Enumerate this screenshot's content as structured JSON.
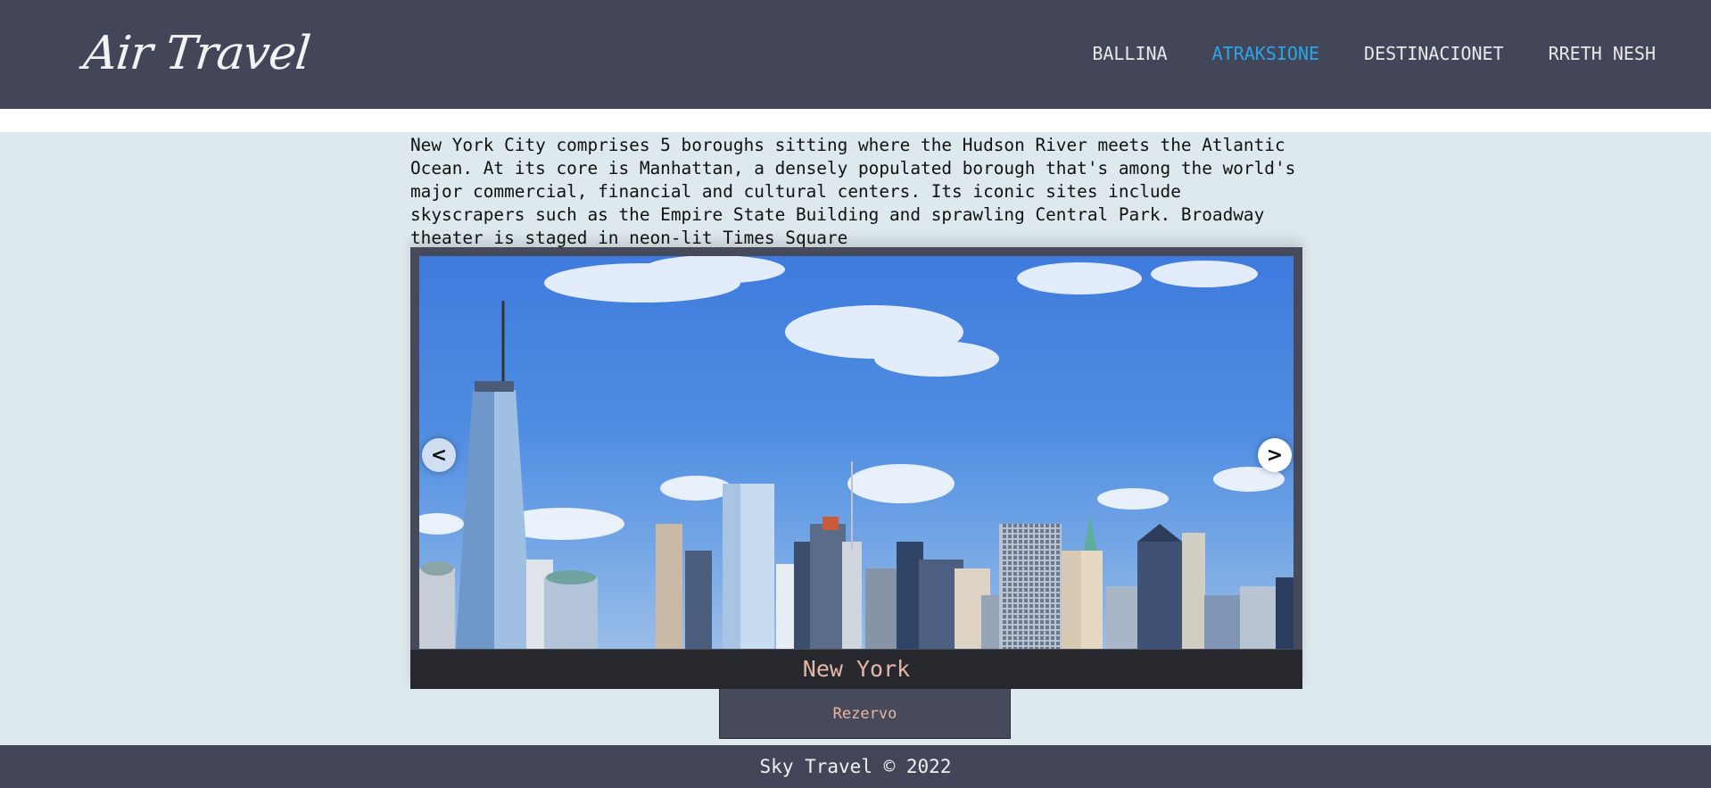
{
  "header": {
    "logo": "Air Travel",
    "nav": [
      {
        "label": "BALLINA"
      },
      {
        "label": "ATRAKSIONE"
      },
      {
        "label": "DESTINACIONET"
      },
      {
        "label": "RRETH NESH"
      }
    ],
    "active_nav": "ATRAKSIONE"
  },
  "main": {
    "description": "New York City comprises 5 boroughs sitting where the Hudson River meets the Atlantic Ocean. At its core is Manhattan, a densely populated borough that's among the world's major commercial, financial and cultural centers. Its iconic sites include skyscrapers such as the Empire State Building and sprawling Central Park. Broadway theater is staged in neon-lit Times Square",
    "slider": {
      "prev_label": "<",
      "next_label": ">",
      "caption": "New York"
    },
    "reserve_label": "Rezervo"
  },
  "footer": {
    "text": "Sky Travel © 2022"
  },
  "colors": {
    "header_bg": "#434659",
    "active_nav": "#2aa6e8",
    "page_bg": "#dde9ed",
    "caption_text": "#e4b7a6"
  },
  "icons": {
    "prev": "chevron-left-icon",
    "next": "chevron-right-icon"
  }
}
